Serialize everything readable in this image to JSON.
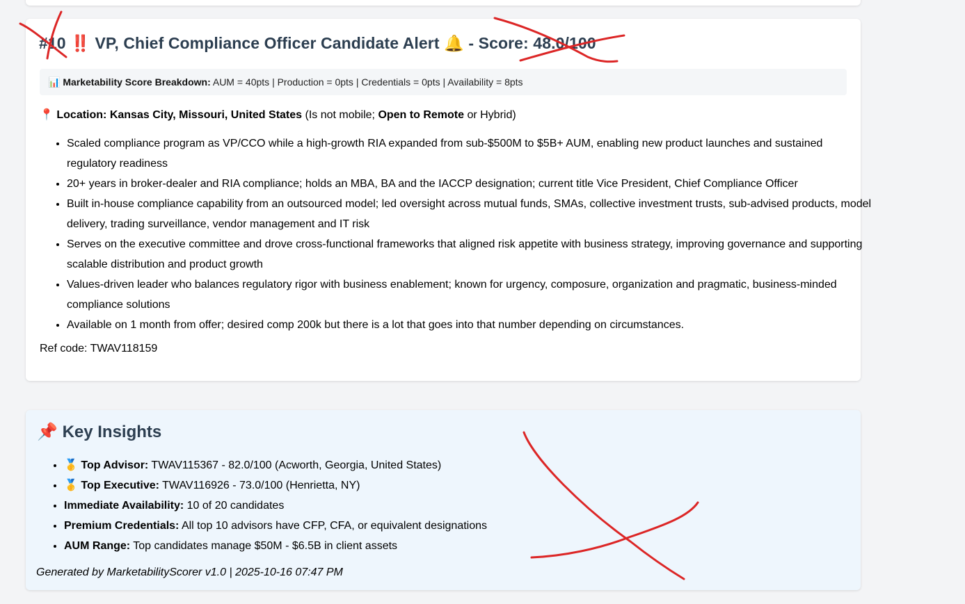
{
  "candidate": {
    "rank": "#10",
    "alert_emoji": "‼️",
    "title": "VP, Chief Compliance Officer Candidate Alert",
    "bell_emoji": "🔔",
    "score_text": "- Score: 48.0/100",
    "breakdown": {
      "emoji": "📊",
      "label": "Marketability Score Breakdown:",
      "text": "AUM = 40pts | Production = 0pts | Credentials = 0pts | Availability = 8pts"
    },
    "location": {
      "emoji": "📍",
      "label": "Location:",
      "place": "Kansas City, Missouri, United States",
      "mobility_prefix": "(Is not mobile;",
      "remote": "Open to Remote",
      "mobility_suffix": "or Hybrid)"
    },
    "bullets": [
      "Scaled compliance program as VP/CCO while a high-growth RIA expanded from sub-$500M to $5B+ AUM, enabling new product launches and sustained regulatory readiness",
      "20+ years in broker-dealer and RIA compliance; holds an MBA, BA and the IACCP designation; current title Vice President, Chief Compliance Officer",
      "Built in-house compliance capability from an outsourced model; led oversight across mutual funds, SMAs, collective investment trusts, sub-advised products, model delivery, trading surveillance, vendor management and IT risk",
      "Serves on the executive committee and drove cross-functional frameworks that aligned risk appetite with business strategy, improving governance and supporting scalable distribution and product growth",
      "Values-driven leader who balances regulatory rigor with business enablement; known for urgency, composure, organization and pragmatic, business-minded compliance solutions",
      "Available on 1 month from offer; desired comp 200k but there is a lot that goes into that number depending on circumstances."
    ],
    "ref_code": "Ref code: TWAV118159"
  },
  "insights": {
    "emoji": "📌",
    "title": "Key Insights",
    "items": [
      {
        "medal": "🥇",
        "label": "Top Advisor:",
        "text": "TWAV115367 - 82.0/100 (Acworth, Georgia, United States)"
      },
      {
        "medal": "🥇",
        "label": "Top Executive:",
        "text": "TWAV116926 - 73.0/100 (Henrietta, NY)"
      },
      {
        "medal": "",
        "label": "Immediate Availability:",
        "text": "10 of 20 candidates"
      },
      {
        "medal": "",
        "label": "Premium Credentials:",
        "text": "All top 10 advisors have CFP, CFA, or equivalent designations"
      },
      {
        "medal": "",
        "label": "AUM Range:",
        "text": "Top candidates manage $50M - $6.5B in client assets"
      }
    ],
    "footer": "Generated by MarketabilityScorer v1.0 | 2025-10-16 07:47 PM"
  },
  "colors": {
    "heading": "#2c3e50",
    "breakdown_bg": "#f4f6f8",
    "insights_bg": "#eef6fd",
    "annotation_red": "#dc2626"
  }
}
